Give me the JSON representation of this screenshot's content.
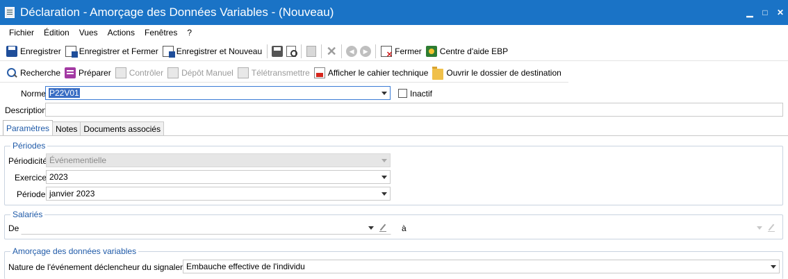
{
  "window": {
    "title": "Déclaration - Amorçage des Données Variables - (Nouveau)",
    "controls": {
      "minimize": "▁",
      "maximize": "□",
      "close": "✕"
    }
  },
  "menu": [
    "Fichier",
    "Édition",
    "Vues",
    "Actions",
    "Fenêtres",
    "?"
  ],
  "toolbar1": {
    "save": "Enregistrer",
    "save_close": "Enregistrer et Fermer",
    "save_new": "Enregistrer et Nouveau",
    "close": "Fermer",
    "help": "Centre d'aide EBP"
  },
  "toolbar2": {
    "search": "Recherche",
    "prepare": "Préparer",
    "check": "Contrôler",
    "manual_deposit": "Dépôt Manuel",
    "transmit": "Télétransmettre",
    "show_spec": "Afficher le cahier technique",
    "open_folder": "Ouvrir le dossier de destination"
  },
  "form": {
    "name_label": "Norme",
    "name_value": "P22V01",
    "inactive_label": "Inactif",
    "inactive_checked": false,
    "description_label": "Description",
    "description_value": ""
  },
  "tabs": [
    "Paramètres",
    "Notes",
    "Documents associés"
  ],
  "active_tab": "Paramètres",
  "periods": {
    "title": "Périodes",
    "periodicity_label": "Périodicité",
    "periodicity_value": "Événementielle",
    "year_label": "Exercice",
    "year_value": "2023",
    "period_label": "Période",
    "period_value": "janvier 2023"
  },
  "employees": {
    "title": "Salariés",
    "from_label": "De",
    "from_value": "",
    "to_label": "à",
    "to_value": ""
  },
  "variables": {
    "title": "Amorçage des données variables",
    "event_label": "Nature de l'événement déclencheur du signalement",
    "event_value": "Embauche effective de l'individu"
  }
}
